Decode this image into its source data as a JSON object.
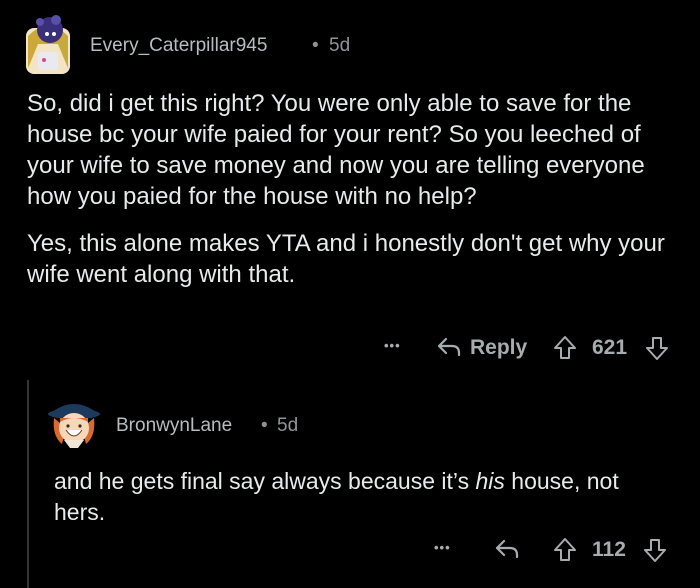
{
  "comment": {
    "username": "Every_Caterpillar945",
    "separator": "•",
    "age": "5d",
    "paragraphs": [
      "So, did i get this right? You were only able to save for the house bc your wife paied for your rent? So you leeched of your wife to save money and now you are telling everyone how you paied for the house with no help?",
      "Yes, this alone makes YTA and i honestly don't get why your wife went along with that."
    ],
    "more_label": "•••",
    "reply_label": "Reply",
    "score": "621"
  },
  "reply": {
    "username": "BronwynLane",
    "separator": "•",
    "age": "5d",
    "text_before": "and he gets final say always because it’s ",
    "text_em": "his",
    "text_after": " house, not hers.",
    "more_label": "•••",
    "score": "112"
  },
  "icons": {
    "reply": "reply-arrow-icon",
    "upvote": "upvote-arrow-icon",
    "downvote": "downvote-arrow-icon"
  },
  "colors": {
    "background": "#000000",
    "text": "#e8eaeb",
    "muted": "#8f9496",
    "thread_line": "#343536"
  }
}
